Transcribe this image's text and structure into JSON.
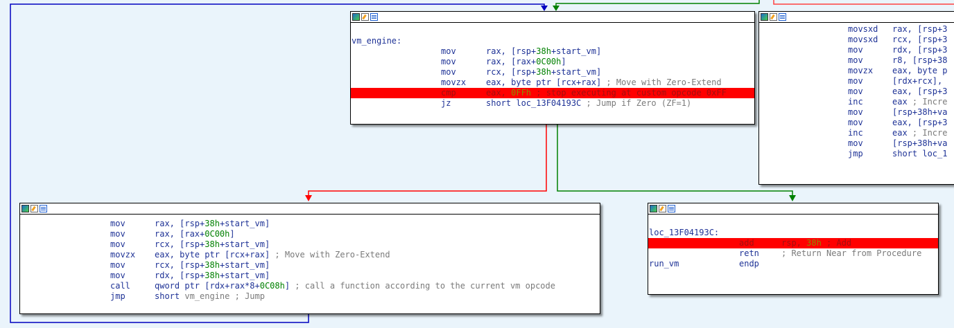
{
  "colors": {
    "background": "#eaf4fb",
    "edge_true": "#008000",
    "edge_false": "#ff0000",
    "edge_jump": "#0000c0",
    "highlight": "#ff0000"
  },
  "nodes": {
    "vm_engine": {
      "label": "vm_engine:",
      "rows": [
        {
          "mn": "mov",
          "a": "rax, [rsp+",
          "s": "38h",
          "b": "+start_vm]",
          "c": ""
        },
        {
          "mn": "mov",
          "a": "rax, [rax+",
          "s": "0C00h",
          "b": "]",
          "c": ""
        },
        {
          "mn": "mov",
          "a": "rcx, [rsp+",
          "s": "38h",
          "b": "+start_vm]",
          "c": ""
        },
        {
          "mn": "movzx",
          "a": "eax, byte ptr [rcx+rax]",
          "s": "",
          "b": "",
          "c": " ; Move with Zero-Extend"
        },
        {
          "mn": "cmp",
          "a": "eax, ",
          "s": "0FFh",
          "b": "",
          "c": " ; stop executing at custom opcode 0xFF"
        },
        {
          "mn": "jz",
          "a": "short loc_13F04193C",
          "s": "",
          "b": "",
          "c": " ; Jump if Zero (ZF=1)"
        }
      ]
    },
    "loop_body": {
      "rows": [
        {
          "mn": "movsxd",
          "a": "rax, [rsp+3"
        },
        {
          "mn": "movsxd",
          "a": "rcx, [rsp+3"
        },
        {
          "mn": "mov",
          "a": "rdx, [rsp+3"
        },
        {
          "mn": "mov",
          "a": "r8, [rsp+38"
        },
        {
          "mn": "movzx",
          "a": "eax, byte p"
        },
        {
          "mn": "mov",
          "a": "[rdx+rcx],"
        },
        {
          "mn": "mov",
          "a": "eax, [rsp+3"
        },
        {
          "mn": "inc",
          "a": "eax",
          "c": " ; Incre"
        },
        {
          "mn": "mov",
          "a": "[rsp+38h+va"
        },
        {
          "mn": "mov",
          "a": "eax, [rsp+3"
        },
        {
          "mn": "inc",
          "a": "eax",
          "c": " ; Incre"
        },
        {
          "mn": "mov",
          "a": "[rsp+38h+va"
        },
        {
          "mn": "jmp",
          "a": "short loc_1"
        }
      ]
    },
    "dispatch": {
      "rows": [
        {
          "mn": "mov",
          "a": "rax, [rsp+",
          "s": "38h",
          "b": "+start_vm]",
          "c": ""
        },
        {
          "mn": "mov",
          "a": "rax, [rax+",
          "s": "0C00h",
          "b": "]",
          "c": ""
        },
        {
          "mn": "mov",
          "a": "rcx, [rsp+",
          "s": "38h",
          "b": "+start_vm]",
          "c": ""
        },
        {
          "mn": "movzx",
          "a": "eax, byte ptr [rcx+rax]",
          "s": "",
          "b": "",
          "c": " ; Move with Zero-Extend"
        },
        {
          "mn": "mov",
          "a": "rcx, [rsp+",
          "s": "38h",
          "b": "+start_vm]",
          "c": ""
        },
        {
          "mn": "mov",
          "a": "rdx, [rsp+",
          "s": "38h",
          "b": "+start_vm]",
          "c": ""
        },
        {
          "mn": "call",
          "a": "qword ptr [rdx+rax*8+",
          "s": "0C08h",
          "b": "]",
          "c": " ; call a function according to the current vm opcode"
        },
        {
          "mn": "jmp",
          "a": "short ",
          "s": "",
          "b": "",
          "g": "vm_engine",
          "c": " ; Jump"
        }
      ]
    },
    "exit": {
      "label": "loc_13F04193C:",
      "rows": [
        {
          "mn": "add",
          "a": "rsp, ",
          "s": "38h",
          "c": " ; Add"
        },
        {
          "mn": "retn",
          "a": "",
          "s": "",
          "c": "    ; Return Near from Procedure"
        }
      ],
      "end_label": "run_vm",
      "end_mn": "endp"
    }
  }
}
